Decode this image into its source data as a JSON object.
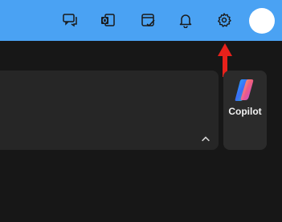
{
  "toolbar": {
    "buttons": [
      {
        "icon": "chat-bubbles-icon"
      },
      {
        "icon": "outlook-icon"
      },
      {
        "icon": "notepad-check-icon"
      },
      {
        "icon": "bell-icon"
      },
      {
        "icon": "gear-icon"
      }
    ],
    "accent_color": "#4aa2f3",
    "avatar_color": "#ffffff"
  },
  "annotation": {
    "icon": "red-arrow-up",
    "color": "#e8211b",
    "points_to": "settings"
  },
  "panel": {
    "collapse_icon": "chevron-up-icon"
  },
  "copilot": {
    "label": "Copilot",
    "icon": "copilot-logo-icon"
  }
}
